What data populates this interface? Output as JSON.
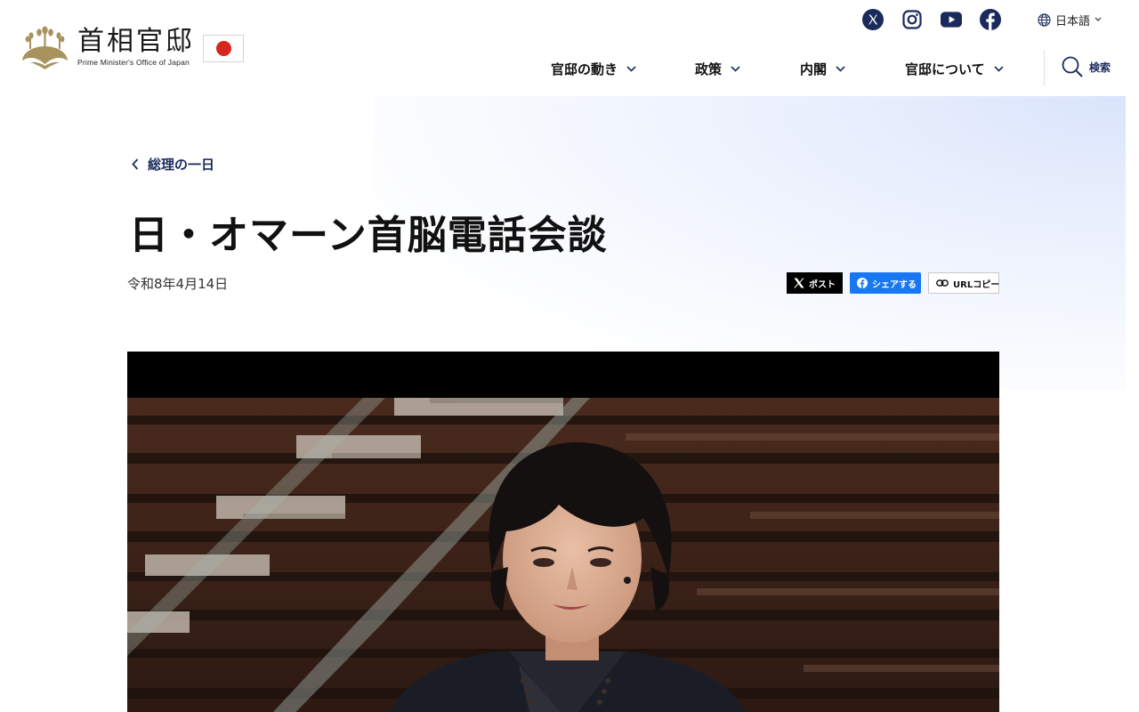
{
  "header": {
    "logo_title": "首相官邸",
    "logo_subtitle": "Prime Minister's Office of Japan",
    "socials": [
      {
        "name": "x-icon"
      },
      {
        "name": "instagram-icon"
      },
      {
        "name": "youtube-icon"
      },
      {
        "name": "facebook-icon"
      }
    ],
    "language": "日本語",
    "nav": [
      {
        "label": "官邸の動き"
      },
      {
        "label": "政策"
      },
      {
        "label": "内閣"
      },
      {
        "label": "官邸について"
      }
    ],
    "search_label": "検索"
  },
  "article": {
    "breadcrumb": "総理の一日",
    "title": "日・オマーン首脳電話会談",
    "date": "令和8年4月14日"
  },
  "share": {
    "x_label": "ポスト",
    "fb_label": "シェアする",
    "url_label": "URLコピー"
  },
  "colors": {
    "nav_accent": "#1b2a5c",
    "logo_gold": "#a8935e",
    "flag_red": "#d7261e",
    "facebook_blue": "#1877f2"
  }
}
